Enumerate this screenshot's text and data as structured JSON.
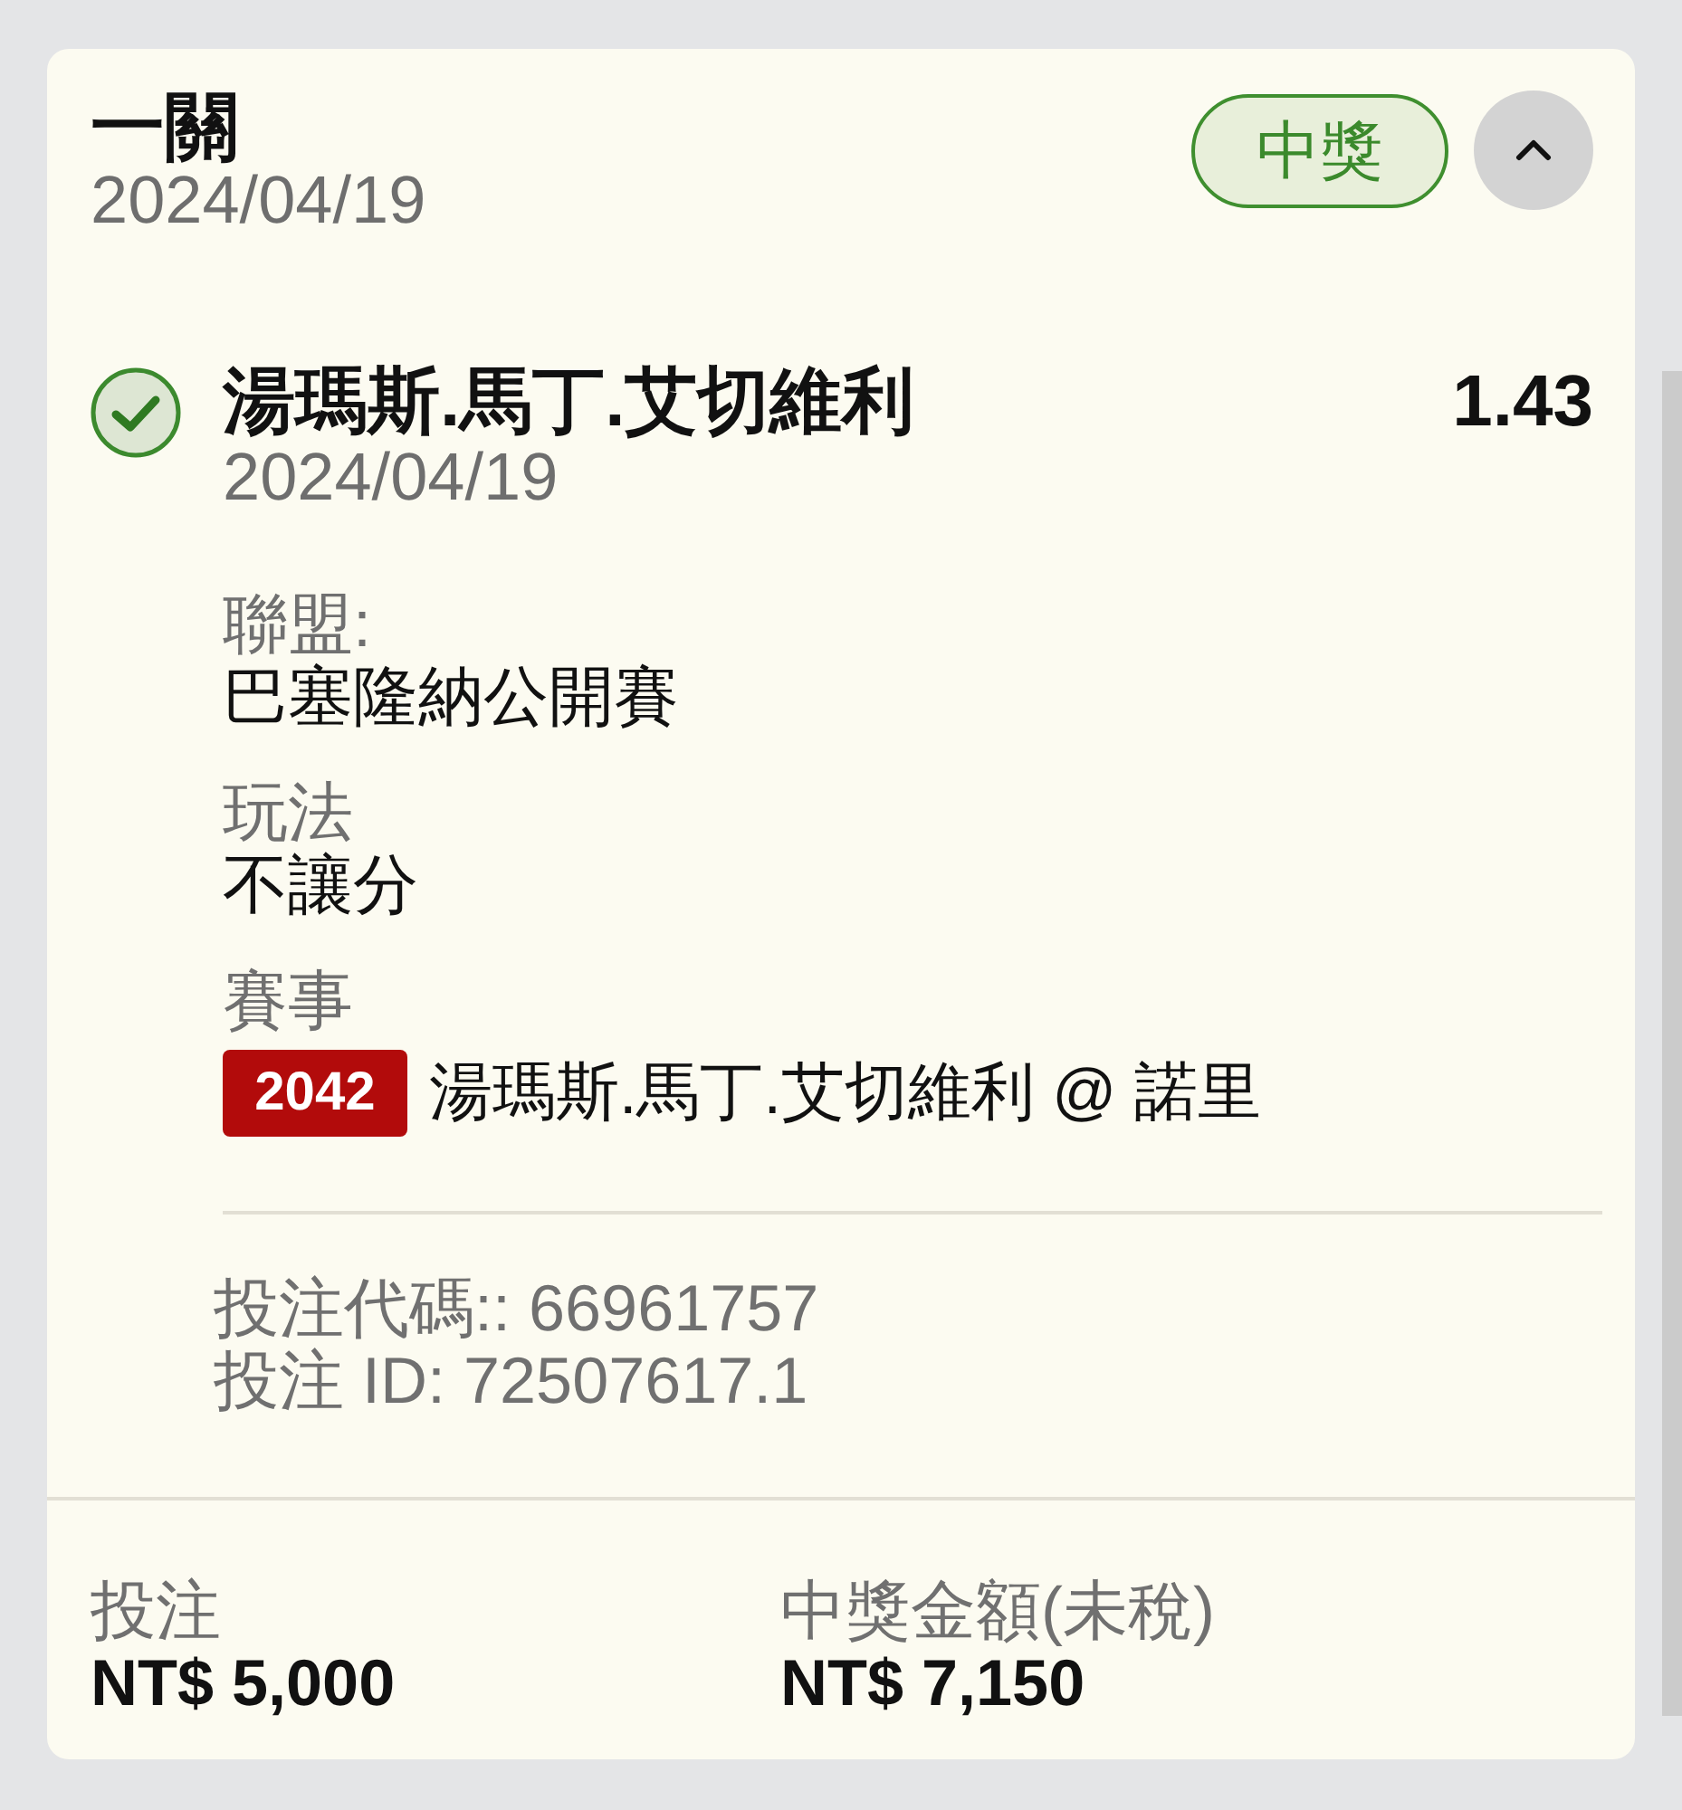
{
  "slip": {
    "title": "一關",
    "date": "2024/04/19",
    "status_label": "中獎",
    "won": true,
    "expanded": true
  },
  "selections": [
    {
      "won": true,
      "name": "湯瑪斯.馬丁.艾切維利",
      "odds": "1.43",
      "date": "2024/04/19",
      "details": [
        {
          "label": "聯盟:",
          "value": "巴塞隆納公開賽"
        },
        {
          "label": "玩法",
          "value": "不讓分"
        },
        {
          "label": "賽事",
          "event_number": "2042",
          "value": "湯瑪斯.馬丁.艾切維利 @ 諾里"
        }
      ],
      "bet_code": "投注代碼:: 66961757",
      "bet_id": "投注 ID: 72507617.1"
    }
  ],
  "summary": [
    {
      "label": "投注",
      "value": "NT$ 5,000"
    },
    {
      "label": "中獎金額(未稅)",
      "value": "NT$ 7,150"
    }
  ]
}
